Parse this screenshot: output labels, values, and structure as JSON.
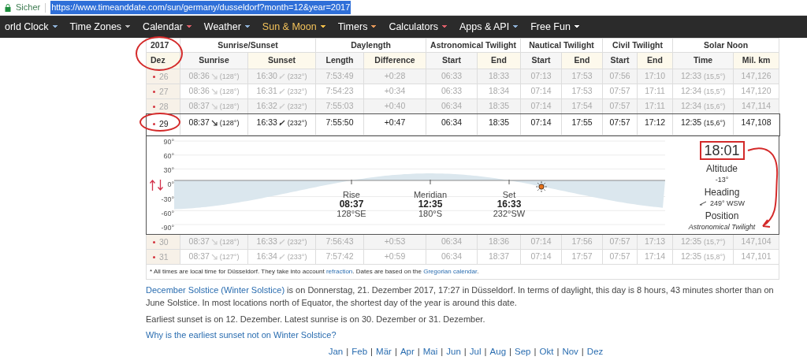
{
  "address_bar": {
    "security_label": "Sicher",
    "url": "https://www.timeanddate.com/sun/germany/dusseldorf?month=12&year=2017"
  },
  "nav": [
    {
      "label": "orld Clock",
      "selected": false,
      "color": "#8fb3d9"
    },
    {
      "label": "Time Zones",
      "selected": false,
      "color": "#bbbbbb"
    },
    {
      "label": "Calendar",
      "selected": false,
      "color": "#e0606a"
    },
    {
      "label": "Weather",
      "selected": false,
      "color": "#8fb3d9"
    },
    {
      "label": "Sun & Moon",
      "selected": true,
      "color": "#f5c04a"
    },
    {
      "label": "Timers",
      "selected": false,
      "color": "#e99a5a"
    },
    {
      "label": "Calculators",
      "selected": false,
      "color": "#e0606a"
    },
    {
      "label": "Apps & API",
      "selected": false,
      "color": "#8fb3d9"
    },
    {
      "label": "Free Fun",
      "selected": false,
      "color": "#ffffff"
    }
  ],
  "table": {
    "year": "2017",
    "month": "Dez",
    "groups": [
      {
        "label": "Sunrise/Sunset",
        "columns": [
          "Sunrise",
          "Sunset"
        ]
      },
      {
        "label": "Daylength",
        "columns": [
          "Length",
          "Difference"
        ]
      },
      {
        "label": "Astronomical Twilight",
        "columns": [
          "Start",
          "End"
        ]
      },
      {
        "label": "Nautical Twilight",
        "columns": [
          "Start",
          "End"
        ]
      },
      {
        "label": "Civil Twilight",
        "columns": [
          "Start",
          "End"
        ]
      },
      {
        "label": "Solar Noon",
        "columns": [
          "Time",
          "Mil. km"
        ]
      }
    ],
    "rows": [
      {
        "day": "26",
        "selected": false,
        "sunrise": "08:36",
        "sunrise_angle": "(128°)",
        "sunset": "16:30",
        "sunset_angle": "(232°)",
        "length": "7:53:49",
        "difference": "+0:28",
        "astro_start": "06:33",
        "astro_end": "18:33",
        "nautical_start": "07:13",
        "nautical_end": "17:53",
        "civil_start": "07:56",
        "civil_end": "17:10",
        "noon": "12:33",
        "noon_altitude": "(15,5°)",
        "distance": "147,126"
      },
      {
        "day": "27",
        "selected": false,
        "sunrise": "08:36",
        "sunrise_angle": "(128°)",
        "sunset": "16:31",
        "sunset_angle": "(232°)",
        "length": "7:54:23",
        "difference": "+0:34",
        "astro_start": "06:33",
        "astro_end": "18:34",
        "nautical_start": "07:14",
        "nautical_end": "17:53",
        "civil_start": "07:57",
        "civil_end": "17:11",
        "noon": "12:34",
        "noon_altitude": "(15,5°)",
        "distance": "147,120"
      },
      {
        "day": "28",
        "selected": false,
        "sunrise": "08:37",
        "sunrise_angle": "(128°)",
        "sunset": "16:32",
        "sunset_angle": "(232°)",
        "length": "7:55:03",
        "difference": "+0:40",
        "astro_start": "06:34",
        "astro_end": "18:35",
        "nautical_start": "07:14",
        "nautical_end": "17:54",
        "civil_start": "07:57",
        "civil_end": "17:11",
        "noon": "12:34",
        "noon_altitude": "(15,6°)",
        "distance": "147,114"
      },
      {
        "day": "29",
        "selected": true,
        "sunrise": "08:37",
        "sunrise_angle": "(128°)",
        "sunset": "16:33",
        "sunset_angle": "(232°)",
        "length": "7:55:50",
        "difference": "+0:47",
        "astro_start": "06:34",
        "astro_end": "18:35",
        "nautical_start": "07:14",
        "nautical_end": "17:55",
        "civil_start": "07:57",
        "civil_end": "17:12",
        "noon": "12:35",
        "noon_altitude": "(15,6°)",
        "distance": "147,108"
      },
      {
        "day": "30",
        "selected": false,
        "sunrise": "08:37",
        "sunrise_angle": "(128°)",
        "sunset": "16:33",
        "sunset_angle": "(232°)",
        "length": "7:56:43",
        "difference": "+0:53",
        "astro_start": "06:34",
        "astro_end": "18:36",
        "nautical_start": "07:14",
        "nautical_end": "17:56",
        "civil_start": "07:57",
        "civil_end": "17:13",
        "noon": "12:35",
        "noon_altitude": "(15,7°)",
        "distance": "147,104"
      },
      {
        "day": "31",
        "selected": false,
        "sunrise": "08:37",
        "sunrise_angle": "(127°)",
        "sunset": "16:34",
        "sunset_angle": "(233°)",
        "length": "7:57:42",
        "difference": "+0:59",
        "astro_start": "06:34",
        "astro_end": "18:37",
        "nautical_start": "07:14",
        "nautical_end": "17:57",
        "civil_start": "07:57",
        "civil_end": "17:14",
        "noon": "12:35",
        "noon_altitude": "(15,8°)",
        "distance": "147,101"
      }
    ],
    "detail": {
      "y_labels": [
        "90°",
        "60°",
        "30°",
        "0°",
        "-30°",
        "-60°",
        "-90°"
      ],
      "events": [
        {
          "label": "Rise",
          "time": "08:37",
          "direction": "128°SE"
        },
        {
          "label": "Meridian",
          "time": "12:35",
          "direction": "180°S"
        },
        {
          "label": "Set",
          "time": "16:33",
          "direction": "232°SW"
        }
      ],
      "current": {
        "time": "18:01",
        "altitude_label": "Altitude",
        "altitude": "-13°",
        "heading_label": "Heading",
        "heading": "249° WSW",
        "position_label": "Position",
        "position": "Astronomical Twilight"
      }
    },
    "footnote": [
      {
        "text": "* All times are local time for Düsseldorf. They take into account ",
        "link": false
      },
      {
        "text": "refraction",
        "link": true
      },
      {
        "text": ". Dates are based on the ",
        "link": false
      },
      {
        "text": "Gregorian calendar",
        "link": true
      },
      {
        "text": ".",
        "link": false
      }
    ]
  },
  "solstice_paragraph": [
    {
      "text": "December Solstice (Winter Solstice)",
      "link": true
    },
    {
      "text": " is on Donnerstag, 21. Dezember 2017, 17:27 in Düsseldorf. In terms of daylight, this day is 8 hours, 43 minutes shorter than on June Solstice. In most locations north of Equator, the shortest day of the year is around this date.",
      "link": false
    }
  ],
  "sunset_paragraph": "Earliest sunset is on 12. Dezember. Latest sunrise is on 30. Dezember or 31. Dezember.",
  "question_link": "Why is the earliest sunset not on Winter Solstice?",
  "months": {
    "separator": "|",
    "items": [
      "Jan",
      "Feb",
      "Mär",
      "Apr",
      "Mai",
      "Jun",
      "Jul",
      "Aug",
      "Sep",
      "Okt",
      "Nov",
      "Dez"
    ]
  }
}
